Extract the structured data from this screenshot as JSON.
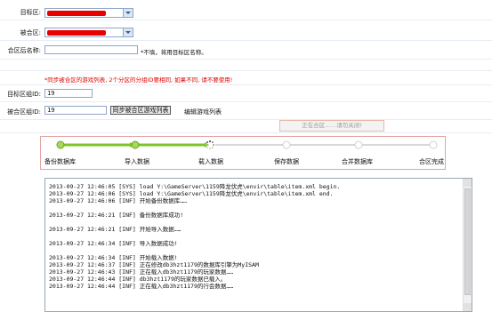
{
  "form": {
    "target_label": "目标区:",
    "merged_label": "被合区:",
    "post_merge_name_label": "合区后名称:",
    "post_merge_name_value": "",
    "post_merge_name_hint": "*不填，将用目标区名称。",
    "warning": "*同步被合区的游戏列表, 2个分区的分组ID要相同, 如果不同, 请不要使用!",
    "target_group_label": "目标区组ID:",
    "target_group_value": "19",
    "merged_group_label": "被合区组ID:",
    "merged_group_value": "19",
    "sync_button": "同步被合区游戏列表",
    "edit_link": "编辑游戏列表",
    "merging_status": "正在合区……请勿关闭!"
  },
  "steps": [
    {
      "label": "备份数据库",
      "state": "done"
    },
    {
      "label": "导入数据",
      "state": "done"
    },
    {
      "label": "载入数据",
      "state": "active"
    },
    {
      "label": "保存数据",
      "state": "pending"
    },
    {
      "label": "合并数据库",
      "state": "pending"
    },
    {
      "label": "合区完成",
      "state": "pending"
    }
  ],
  "colors": {
    "accent_green": "#7bc52a",
    "pending_gray": "#d8d8d8",
    "warning_red": "#e00000"
  },
  "log_lines": [
    "2013-09-27 12:46:05 [SYS] load Y:\\GameServer\\1159降龙伏虎\\envir\\table\\item.xml begin.",
    "2013-09-27 12:46:06 [SYS] load Y:\\GameServer\\1159降龙伏虎\\envir\\table\\item.xml end.",
    "2013-09-27 12:46:06 [INF] 开始备份数据库……",
    "",
    "2013-09-27 12:46:21 [INF] 备份数据库成功!",
    "",
    "2013-09-27 12:46:21 [INF] 开始导入数据……",
    "",
    "2013-09-27 12:46:34 [INF] 导入数据成功!",
    "",
    "2013-09-27 12:46:34 [INF] 开始载入数据!",
    "2013-09-27 12:46:37 [INF] 正在修改db3hzt1179的数据库引擎为MyISAM",
    "2013-09-27 12:46:43 [INF] 正在载入db3hzt1179的玩家数据……",
    "2013-09-27 12:46:44 [INF] db3hzt1179的玩家数据已载入。",
    "2013-09-27 12:46:44 [INF] 正在载入db3hzt1179的行会数据……"
  ]
}
